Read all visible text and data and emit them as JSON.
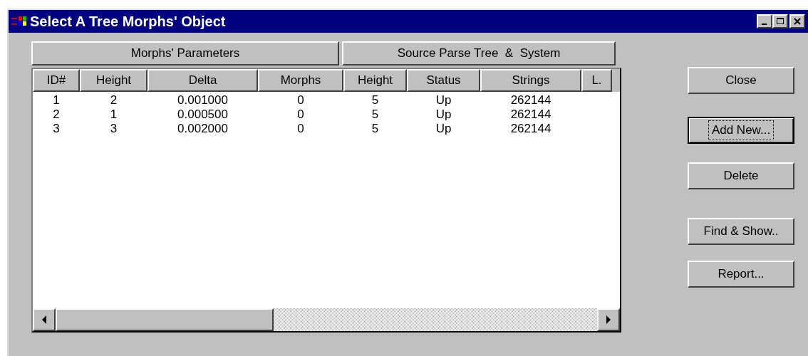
{
  "window": {
    "title": "Select A Tree Morphs' Object"
  },
  "title_buttons": [
    {
      "kind": "minimize"
    },
    {
      "kind": "maximize"
    },
    {
      "kind": "close"
    }
  ],
  "column_groups": [
    "Morphs' Parameters",
    "Source Parse Tree  &  System"
  ],
  "table": {
    "columns": [
      "ID#",
      "Height",
      "Delta",
      "Morphs",
      "Height",
      "Status",
      "Strings",
      "L."
    ],
    "rows": [
      [
        "1",
        "2",
        "0.001000",
        "0",
        "5",
        "Up",
        "262144"
      ],
      [
        "2",
        "1",
        "0.000500",
        "0",
        "5",
        "Up",
        "262144"
      ],
      [
        "3",
        "3",
        "0.002000",
        "0",
        "5",
        "Up",
        "262144"
      ]
    ]
  },
  "buttons": [
    {
      "label": "Close",
      "focused": false
    },
    {
      "label": "Add New...",
      "focused": true
    },
    {
      "label": "Delete",
      "focused": false
    },
    {
      "label": "Find & Show..",
      "focused": false
    },
    {
      "label": "Report...",
      "focused": false
    }
  ]
}
